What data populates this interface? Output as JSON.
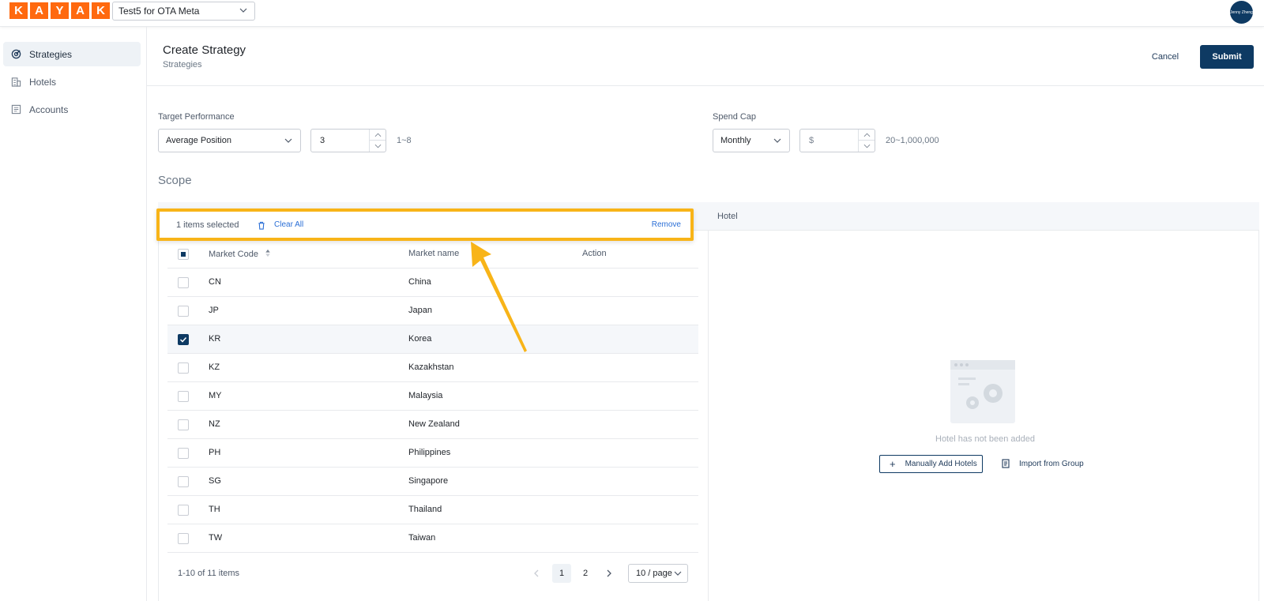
{
  "brand": {
    "letters": [
      "K",
      "A",
      "Y",
      "A",
      "K"
    ],
    "color": "#ff690f"
  },
  "account_selector": {
    "value": "Test5 for OTA Meta"
  },
  "user": {
    "avatar_text": "Jenny Zheng"
  },
  "sidebar": {
    "items": [
      {
        "label": "Strategies",
        "icon": "target-icon",
        "active": true
      },
      {
        "label": "Hotels",
        "icon": "building-icon",
        "active": false
      },
      {
        "label": "Accounts",
        "icon": "ledger-icon",
        "active": false
      }
    ]
  },
  "header": {
    "title": "Create Strategy",
    "breadcrumb": "Strategies",
    "cancel_label": "Cancel",
    "submit_label": "Submit"
  },
  "form": {
    "target_performance": {
      "label": "Target Performance",
      "metric": "Average Position",
      "value": "3",
      "range_hint": "1~8"
    },
    "spend_cap": {
      "label": "Spend Cap",
      "period": "Monthly",
      "placeholder": "$",
      "range_hint": "20~1,000,000"
    }
  },
  "scope": {
    "title": "Scope",
    "selection_bar": {
      "count_text": "1 items selected",
      "clear_label": "Clear All",
      "remove_label": "Remove"
    },
    "columns": [
      "Market Code",
      "Market name",
      "Action"
    ],
    "rows": [
      {
        "code": "CN",
        "name": "China",
        "checked": false
      },
      {
        "code": "JP",
        "name": "Japan",
        "checked": false
      },
      {
        "code": "KR",
        "name": "Korea",
        "checked": true
      },
      {
        "code": "KZ",
        "name": "Kazakhstan",
        "checked": false
      },
      {
        "code": "MY",
        "name": "Malaysia",
        "checked": false
      },
      {
        "code": "NZ",
        "name": "New Zealand",
        "checked": false
      },
      {
        "code": "PH",
        "name": "Philippines",
        "checked": false
      },
      {
        "code": "SG",
        "name": "Singapore",
        "checked": false
      },
      {
        "code": "TH",
        "name": "Thailand",
        "checked": false
      },
      {
        "code": "TW",
        "name": "Taiwan",
        "checked": false
      }
    ],
    "pagination": {
      "total_text": "1-10 of 11 items",
      "pages": [
        "1",
        "2"
      ],
      "current": "1",
      "page_size": "10 / page"
    }
  },
  "hotel_panel": {
    "header": "Hotel",
    "empty_text": "Hotel has not been added",
    "manual_add_label": "Manually Add Hotels",
    "import_label": "Import from Group"
  },
  "colors": {
    "primary": "#0e3a63",
    "highlight": "#f8b418",
    "link": "#2b6fd6"
  }
}
